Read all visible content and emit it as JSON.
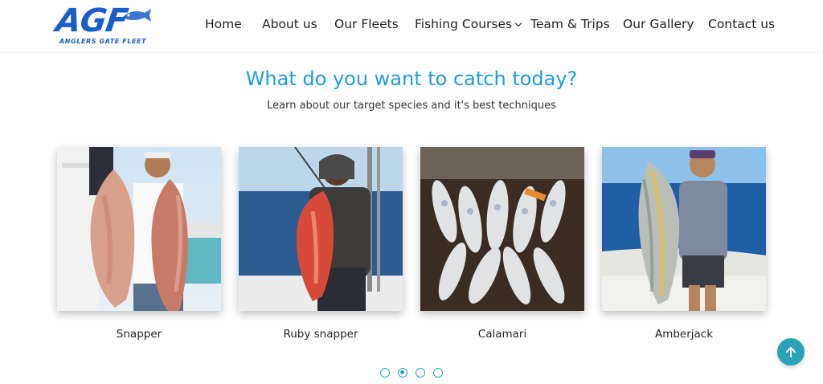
{
  "brand": {
    "logo_text": "AGF",
    "logo_subtitle": "ANGLERS GATE FLEET",
    "brand_color": "#1a5dc8"
  },
  "nav": {
    "items": [
      {
        "label": "Home"
      },
      {
        "label": "About us"
      },
      {
        "label": "Our Fleets"
      },
      {
        "label": "Fishing Courses",
        "has_dropdown": true
      },
      {
        "label": "Team & Trips"
      },
      {
        "label": "Our Gallery"
      },
      {
        "label": "Contact us"
      }
    ]
  },
  "hero": {
    "title": "What do you want to catch today?",
    "subtitle": "Learn about our target species and it's best techniques",
    "title_color": "#1e9be0"
  },
  "species": [
    {
      "name": "Snapper",
      "image": "photo-two-men-holding-red-snappers"
    },
    {
      "name": "Ruby snapper",
      "image": "photo-angler-holding-ruby-snapper-on-boat"
    },
    {
      "name": "Calamari",
      "image": "photo-squid-catch-on-deck"
    },
    {
      "name": "Amberjack",
      "image": "photo-angler-holding-amberjack-on-boat"
    }
  ],
  "carousel": {
    "total_pages": 4,
    "active_page": 2,
    "accent": "#2aa3b8"
  },
  "scroll_top": {
    "icon": "arrow-up-icon"
  }
}
